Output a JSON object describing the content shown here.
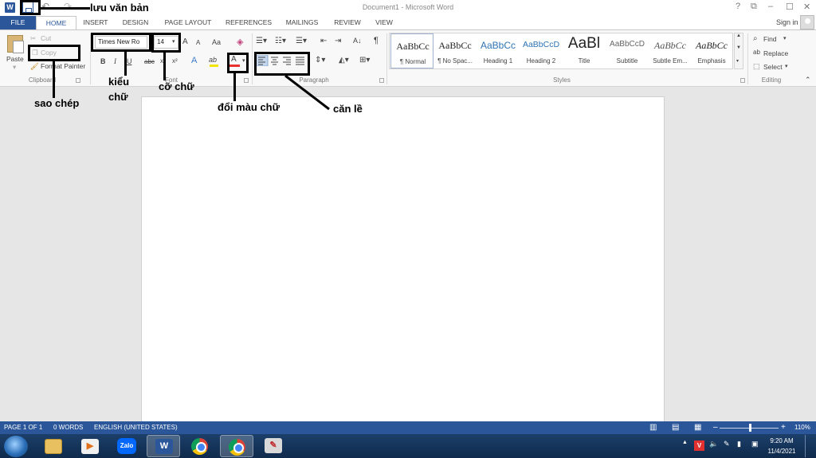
{
  "titlebar": {
    "app_letter": "W",
    "doc_title": "Document1 - Microsoft Word",
    "help": "?",
    "restore": "⧉",
    "minimize": "–",
    "maximize": "☐",
    "close": "✕"
  },
  "tabs": [
    "FILE",
    "HOME",
    "INSERT",
    "DESIGN",
    "PAGE LAYOUT",
    "REFERENCES",
    "MAILINGS",
    "REVIEW",
    "VIEW"
  ],
  "sign_in": "Sign in",
  "clipboard": {
    "paste": "Paste",
    "cut": "Cut",
    "copy": "Copy",
    "format_painter": "Format Painter",
    "group": "Clipboard"
  },
  "font": {
    "name": "Times New Ro",
    "size": "14",
    "grow": "A",
    "shrink": "A",
    "case": "Aa",
    "bold": "B",
    "italic": "I",
    "underline": "U",
    "strike": "abc",
    "subscript": "x₂",
    "superscript": "x²",
    "effects": "A",
    "highlight": "ab",
    "font_color": "A",
    "group": "Font"
  },
  "paragraph": {
    "group": "Paragraph",
    "pilcrow": "¶",
    "sort": "A↓"
  },
  "styles": {
    "group": "Styles",
    "items": [
      {
        "preview": "AaBbCc",
        "name": "¶ Normal"
      },
      {
        "preview": "AaBbCc",
        "name": "¶ No Spac..."
      },
      {
        "preview": "AaBbCc",
        "name": "Heading 1"
      },
      {
        "preview": "AaBbCcD",
        "name": "Heading 2"
      },
      {
        "preview": "AaBl",
        "name": "Title"
      },
      {
        "preview": "AaBbCcD",
        "name": "Subtitle"
      },
      {
        "preview": "AaBbCc",
        "name": "Subtle Em..."
      },
      {
        "preview": "AaBbCc",
        "name": "Emphasis"
      }
    ]
  },
  "editing": {
    "find": "Find",
    "replace": "Replace",
    "select": "Select",
    "group": "Editing"
  },
  "statusbar": {
    "page": "PAGE 1 OF 1",
    "words": "0 WORDS",
    "language": "ENGLISH (UNITED STATES)",
    "zoom": "110%",
    "minus": "–",
    "plus": "+"
  },
  "taskbar": {
    "zalo": "Zalo",
    "word": "W",
    "time": "9:20 AM",
    "date": "11/4/2021"
  },
  "annotations": {
    "save": "lưu văn bản",
    "copy": "sao chép",
    "font_face_1": "kiểu",
    "font_face_2": "chữ",
    "font_size": "cỡ chữ",
    "font_color": "đổi màu chữ",
    "align": "căn lề"
  },
  "colors": {
    "word_blue": "#2b579a",
    "font_color_red": "#e8312f",
    "highlight_yellow": "#f2e600"
  }
}
